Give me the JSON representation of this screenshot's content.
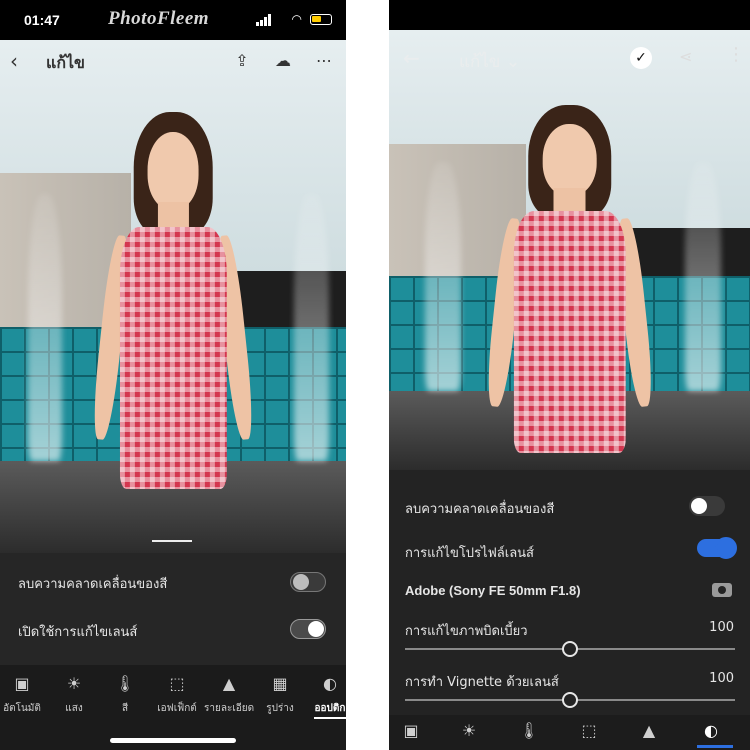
{
  "left_phone": {
    "status": {
      "time": "01:47",
      "watermark": "PhotoFleem"
    },
    "toolbar": {
      "back_icon": "chevron-left-icon",
      "title": "แก้ไข",
      "icons": [
        "export-icon",
        "cloud-sync-icon",
        "more-icon"
      ]
    },
    "panel": {
      "rows": [
        {
          "label": "ลบความคลาดเคลื่อนของสี",
          "enabled": false
        },
        {
          "label": "เปิดใช้การแก้ไขเลนส์",
          "enabled": true
        }
      ]
    },
    "tabs": [
      {
        "label": "อัตโนมัติ",
        "icon": "auto-icon"
      },
      {
        "label": "แสง",
        "icon": "sun-icon"
      },
      {
        "label": "สี",
        "icon": "thermometer-icon"
      },
      {
        "label": "เอฟเฟ็กต์",
        "icon": "effects-icon"
      },
      {
        "label": "รายละเอียด",
        "icon": "detail-icon"
      },
      {
        "label": "รูปร่าง",
        "icon": "geometry-icon"
      },
      {
        "label": "ออปติก",
        "icon": "optics-icon",
        "active": true
      }
    ]
  },
  "right_phone": {
    "toolbar": {
      "back_icon": "arrow-left-icon",
      "title": "แก้ไข ⌄",
      "icons": [
        "checkmark-icon",
        "share-icon",
        "more-vertical-icon"
      ]
    },
    "panel": {
      "chromatic_label": "ลบความคลาดเคลื่อนของสี",
      "chromatic_enabled": false,
      "profile_label": "การแก้ไขโปรไฟล์เลนส์",
      "profile_enabled": true,
      "lens_name": "Adobe (Sony FE 50mm F1.8)",
      "distortion_label": "การแก้ไขภาพบิดเบี้ยว",
      "distortion_value": "100",
      "distortion_fraction": 0.5,
      "vignette_label": "การทำ Vignette ด้วยเลนส์",
      "vignette_value": "100",
      "vignette_fraction": 0.5
    },
    "tabs": [
      "auto-icon",
      "sun-icon",
      "thermometer-icon",
      "effects-icon",
      "detail-icon",
      "optics-icon"
    ],
    "active_tab": "optics-icon"
  },
  "colors": {
    "toggle_on": "#2d6fe0",
    "toggle_off_left": "#ffffff",
    "accent": "#2d6fe0"
  }
}
